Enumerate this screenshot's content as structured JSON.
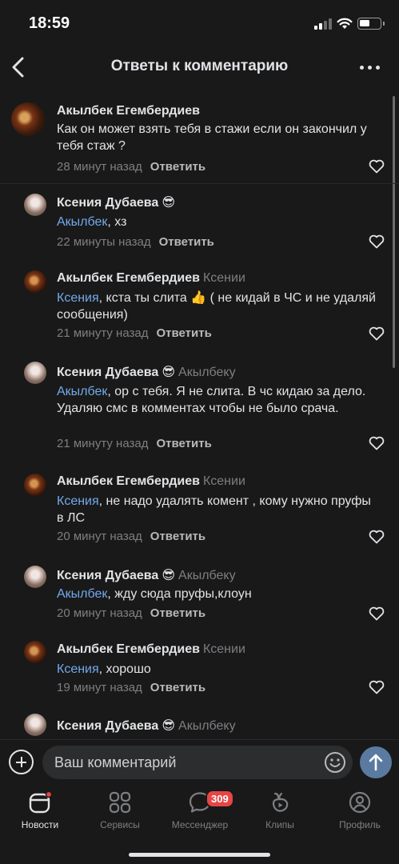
{
  "status_bar": {
    "time": "18:59"
  },
  "header": {
    "title": "Ответы к комментарию"
  },
  "comments": [
    {
      "author": "Акылбек Егембердиев",
      "emoji": "",
      "reply_to": "",
      "mention": "",
      "text": "Как он может взять тебя в стажи если он закончил у тебя стаж ?",
      "time": "28 минут назад",
      "reply_label": "Ответить"
    },
    {
      "author": "Ксения Дубаева",
      "emoji": "😎",
      "reply_to": "",
      "mention": "Акылбек",
      "text": ", хз",
      "time": "22 минуты назад",
      "reply_label": "Ответить"
    },
    {
      "author": "Акылбек Егембердиев",
      "emoji": "",
      "reply_to": "Ксении",
      "mention": "Ксения",
      "text": ", кста ты слита 👍 ( не кидай в ЧС и не удаляй сообщения)",
      "time": "21 минуту назад",
      "reply_label": "Ответить"
    },
    {
      "author": "Ксения Дубаева",
      "emoji": "😎",
      "reply_to": "Акылбеку",
      "mention": "Акылбек",
      "text": ", ор с тебя. Я не слита. В чс кидаю за дело. Удаляю смс в комментах чтобы не было срача.",
      "time": "21 минуту назад",
      "reply_label": "Ответить"
    },
    {
      "author": "Акылбек Егембердиев",
      "emoji": "",
      "reply_to": "Ксении",
      "mention": "Ксения",
      "text": ", не надо удалять комент , кому нужно пруфы в ЛС",
      "time": "20 минут назад",
      "reply_label": "Ответить"
    },
    {
      "author": "Ксения Дубаева",
      "emoji": "😎",
      "reply_to": "Акылбеку",
      "mention": "Акылбек",
      "text": ", жду сюда пруфы,клоун",
      "time": "20 минут назад",
      "reply_label": "Ответить"
    },
    {
      "author": "Акылбек Егембердиев",
      "emoji": "",
      "reply_to": "Ксении",
      "mention": "Ксения",
      "text": ", хорошо",
      "time": "19 минут назад",
      "reply_label": "Ответить"
    },
    {
      "author": "Ксения Дубаева",
      "emoji": "😎",
      "reply_to": "Акылбеку",
      "mention": "",
      "text": "",
      "time": "",
      "reply_label": ""
    }
  ],
  "input": {
    "placeholder": "Ваш комментарий"
  },
  "tabbar": {
    "tabs": [
      {
        "label": "Новости",
        "icon": "news-icon",
        "active": true
      },
      {
        "label": "Сервисы",
        "icon": "services-icon",
        "active": false
      },
      {
        "label": "Мессенджер",
        "icon": "messenger-icon",
        "active": false,
        "badge": "309"
      },
      {
        "label": "Клипы",
        "icon": "clips-icon",
        "active": false
      },
      {
        "label": "Профиль",
        "icon": "profile-icon",
        "active": false
      }
    ]
  },
  "colors": {
    "background": "#191919",
    "mention": "#71aaeb",
    "accent": "#5b7aa2",
    "badge": "#e64646"
  }
}
